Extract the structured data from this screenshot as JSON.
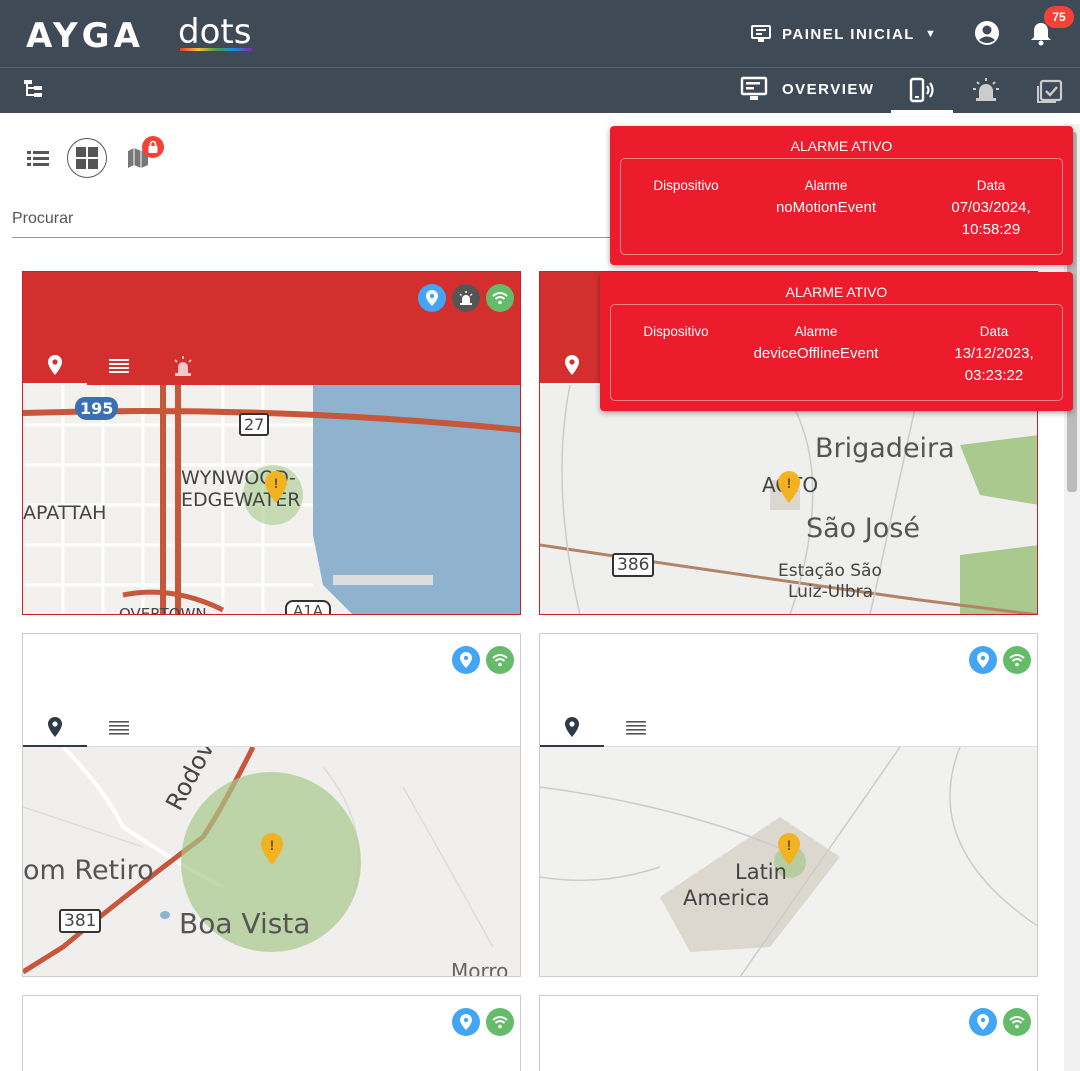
{
  "header": {
    "logo_main": "AYGA",
    "logo_sub": "dots",
    "panel_label": "PAINEL INICIAL",
    "notifications_count": "75"
  },
  "subnav": {
    "overview_label": "OVERVIEW"
  },
  "search": {
    "placeholder": "Procurar"
  },
  "alarms": [
    {
      "title": "ALARME ATIVO",
      "col_device": "Dispositivo",
      "col_alarm": "Alarme",
      "col_date": "Data",
      "alarm": "noMotionEvent",
      "date_line1": "07/03/2024,",
      "date_line2": "10:58:29"
    },
    {
      "title": "ALARME ATIVO",
      "col_device": "Dispositivo",
      "col_alarm": "Alarme",
      "col_date": "Data",
      "alarm": "deviceOfflineEvent",
      "date_line1": "13/12/2023,",
      "date_line2": "03:23:22"
    }
  ],
  "maps": [
    {
      "labels": [
        "195",
        "27",
        "WYNWOOD-",
        "EDGEWATER",
        "APATTAH",
        "A1A",
        "OVERTOWN"
      ]
    },
    {
      "labels": [
        "Brigadeira",
        "AGTO",
        "São José",
        "386",
        "Estação São",
        "Luiz-Ulbra"
      ]
    },
    {
      "labels": [
        "Rodovia",
        "om Retiro",
        "381",
        "Boa Vista",
        "Morro"
      ]
    },
    {
      "labels": [
        "Latin",
        "America"
      ]
    }
  ],
  "colors": {
    "header_bg": "#3f4a57",
    "alarm_red": "#ec1c2d",
    "card_red": "#d32f2f",
    "location_badge": "#42a5f5",
    "signal_badge": "#66bb6a",
    "notification_badge": "#f44336"
  }
}
